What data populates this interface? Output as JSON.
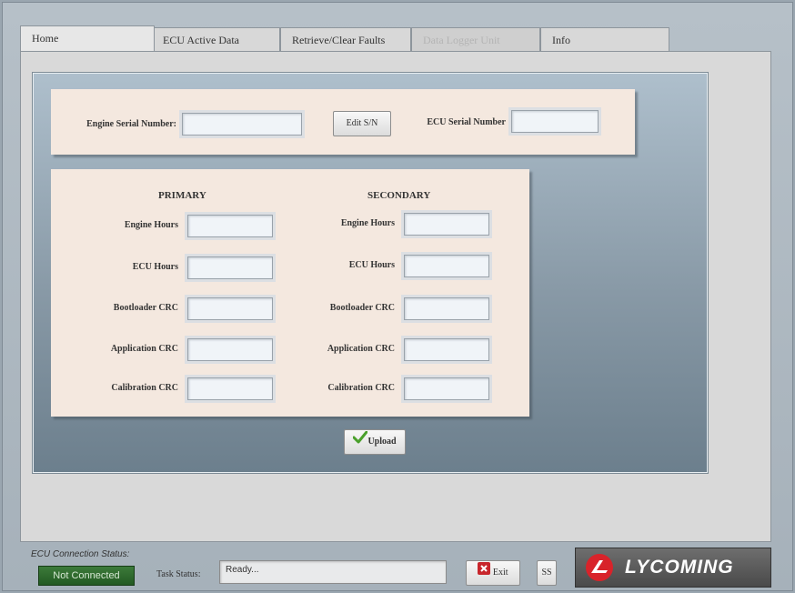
{
  "tabs": [
    {
      "label": "Home",
      "state": "active"
    },
    {
      "label": "ECU Active Data",
      "state": "normal"
    },
    {
      "label": "Retrieve/Clear Faults",
      "state": "normal"
    },
    {
      "label": "Data Logger Unit",
      "state": "disabled"
    },
    {
      "label": "Info",
      "state": "normal"
    }
  ],
  "serial": {
    "engine_label": "Engine Serial Number:",
    "engine_value": "",
    "edit_button": "Edit S/N",
    "ecu_label": "ECU Serial Number",
    "ecu_value": ""
  },
  "primary": {
    "header": "PRIMARY",
    "rows": [
      {
        "label": "Engine Hours",
        "value": ""
      },
      {
        "label": "ECU Hours",
        "value": ""
      },
      {
        "label": "Bootloader CRC",
        "value": ""
      },
      {
        "label": "Application CRC",
        "value": ""
      },
      {
        "label": "Calibration CRC",
        "value": ""
      }
    ]
  },
  "secondary": {
    "header": "SECONDARY",
    "rows": [
      {
        "label": "Engine Hours",
        "value": ""
      },
      {
        "label": "ECU Hours",
        "value": ""
      },
      {
        "label": "Bootloader CRC",
        "value": ""
      },
      {
        "label": "Application CRC",
        "value": ""
      },
      {
        "label": "Calibration CRC",
        "value": ""
      }
    ]
  },
  "upload_button": "Upload",
  "footer": {
    "connection_label": "ECU Connection Status:",
    "connection_status": "Not Connected",
    "task_label": "Task Status:",
    "task_value": "Ready...",
    "exit_button": "Exit",
    "ss_button": "SS",
    "brand": "LYCOMING"
  },
  "colors": {
    "connection_badge": "#2f6b2d",
    "card_background": "#f4e8df",
    "exit_icon": "#c8262c",
    "logo_red": "#d8232a",
    "check_green": "#4aa02c"
  },
  "icons": {
    "upload": "check-icon",
    "exit": "close-icon",
    "logo": "lycoming-logo-icon"
  }
}
